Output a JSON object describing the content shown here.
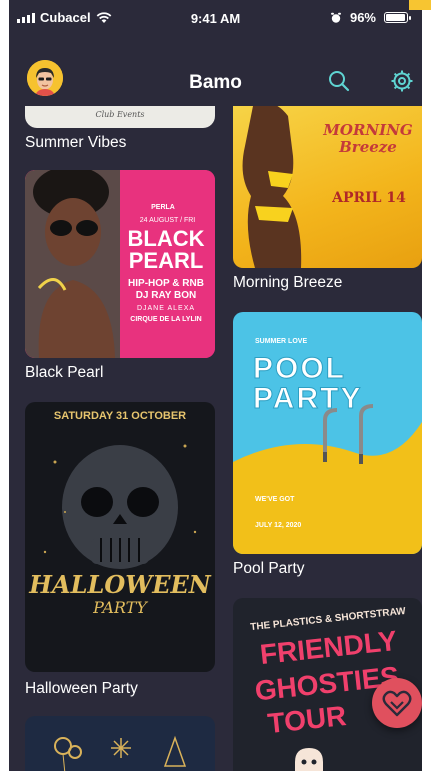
{
  "status_bar": {
    "carrier": "Cubacel",
    "time": "9:41 AM",
    "battery_percent": "96%",
    "battery_level": 0.96
  },
  "nav": {
    "title": "Bamo"
  },
  "events": [
    {
      "title": "Summer Vibes",
      "flyer_text": "Club Events"
    },
    {
      "title": "Morning Breeze",
      "flyer_text": "MORNING Breeze",
      "flyer_sub": "APRIL 14"
    },
    {
      "title": "Black Pearl",
      "flyer_text": "BLACK PEARL",
      "flyer_sub": "HIP-HOP & RNB",
      "flyer_dj": "DJ RAY BON",
      "flyer_date": "24 AUGUST / FRI",
      "flyer_brand": "PERLA",
      "flyer_guests": "DJANE ALEXA",
      "flyer_venue": "CIRQUE DE LA LYLIN"
    },
    {
      "title": "Pool Party",
      "flyer_kicker": "SUMMER LOVE",
      "flyer_text_1": "POOL",
      "flyer_text_2": "PARTY",
      "flyer_lineup": "WE'VE GOT",
      "flyer_date": "JULY 12, 2020"
    },
    {
      "title": "Halloween Party",
      "flyer_date": "SATURDAY 31 OCTOBER",
      "flyer_text_1": "HALLOWEEN",
      "flyer_text_2": "PARTY"
    },
    {
      "title": "Friendly Ghosties Tour",
      "flyer_kicker": "THE PLASTICS & SHORTSTRAW",
      "flyer_text_1": "FRIENDLY",
      "flyer_text_2": "GHOSTIES",
      "flyer_text_3": "TOUR"
    }
  ],
  "icons": {
    "search": "search-icon",
    "settings": "gear-icon",
    "favorite": "heart-icon"
  },
  "colors": {
    "background": "#2b2a3a",
    "accent": "#f6c22f",
    "fab": "#e0505e",
    "icon": "#5fd4d2"
  }
}
